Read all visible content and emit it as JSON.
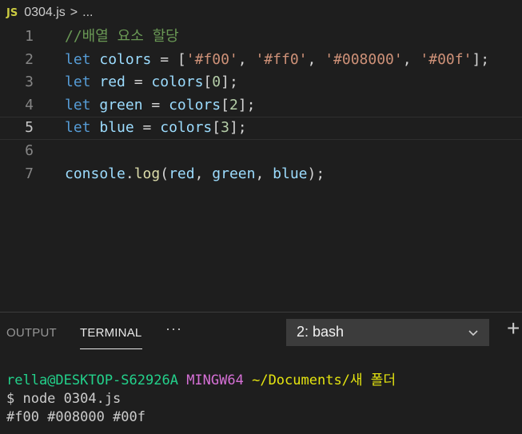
{
  "breadcrumb": {
    "lang_badge": "JS",
    "file_name": "0304.js",
    "separator": ">",
    "more": "..."
  },
  "editor": {
    "lines": [
      {
        "number": "1",
        "tokens": [
          {
            "t": "//배열 요소 할당",
            "k": "comment"
          }
        ]
      },
      {
        "number": "2",
        "tokens": [
          {
            "t": "let",
            "k": "keyword"
          },
          {
            "t": " ",
            "k": "punc"
          },
          {
            "t": "colors",
            "k": "var"
          },
          {
            "t": " = [",
            "k": "punc"
          },
          {
            "t": "'#f00'",
            "k": "str"
          },
          {
            "t": ", ",
            "k": "punc"
          },
          {
            "t": "'#ff0'",
            "k": "str"
          },
          {
            "t": ", ",
            "k": "punc"
          },
          {
            "t": "'#008000'",
            "k": "str"
          },
          {
            "t": ", ",
            "k": "punc"
          },
          {
            "t": "'#00f'",
            "k": "str"
          },
          {
            "t": "];",
            "k": "punc"
          }
        ]
      },
      {
        "number": "3",
        "tokens": [
          {
            "t": "let",
            "k": "keyword"
          },
          {
            "t": " ",
            "k": "punc"
          },
          {
            "t": "red",
            "k": "var"
          },
          {
            "t": " = ",
            "k": "punc"
          },
          {
            "t": "colors",
            "k": "var"
          },
          {
            "t": "[",
            "k": "punc"
          },
          {
            "t": "0",
            "k": "num"
          },
          {
            "t": "];",
            "k": "punc"
          }
        ]
      },
      {
        "number": "4",
        "tokens": [
          {
            "t": "let",
            "k": "keyword"
          },
          {
            "t": " ",
            "k": "punc"
          },
          {
            "t": "green",
            "k": "var"
          },
          {
            "t": " = ",
            "k": "punc"
          },
          {
            "t": "colors",
            "k": "var"
          },
          {
            "t": "[",
            "k": "punc"
          },
          {
            "t": "2",
            "k": "num"
          },
          {
            "t": "];",
            "k": "punc"
          }
        ]
      },
      {
        "number": "5",
        "active": true,
        "tokens": [
          {
            "t": "let",
            "k": "keyword"
          },
          {
            "t": " ",
            "k": "punc"
          },
          {
            "t": "blue",
            "k": "var"
          },
          {
            "t": " = ",
            "k": "punc"
          },
          {
            "t": "colors",
            "k": "var"
          },
          {
            "t": "[",
            "k": "punc"
          },
          {
            "t": "3",
            "k": "num"
          },
          {
            "t": "];",
            "k": "punc"
          }
        ]
      },
      {
        "number": "6",
        "tokens": []
      },
      {
        "number": "7",
        "tokens": [
          {
            "t": "console",
            "k": "var"
          },
          {
            "t": ".",
            "k": "punc"
          },
          {
            "t": "log",
            "k": "fn"
          },
          {
            "t": "(",
            "k": "punc"
          },
          {
            "t": "red",
            "k": "var"
          },
          {
            "t": ", ",
            "k": "punc"
          },
          {
            "t": "green",
            "k": "var"
          },
          {
            "t": ", ",
            "k": "punc"
          },
          {
            "t": "blue",
            "k": "var"
          },
          {
            "t": ");",
            "k": "punc"
          }
        ]
      }
    ]
  },
  "panel": {
    "tab_output": "OUTPUT",
    "tab_terminal": "TERMINAL",
    "more_actions": "···",
    "terminal_select": "2: bash",
    "new_terminal": "+"
  },
  "terminal": {
    "prompt_user": "rella@DESKTOP-S62926A",
    "prompt_system": "MINGW64",
    "prompt_path": "~/Documents/새 폴더",
    "command": "$ node 0304.js",
    "output": "#f00 #008000 #00f"
  },
  "colors": {
    "background": "#1e1e1e",
    "keyword": "#569cd6",
    "variable": "#9cdcfe",
    "string": "#ce9178",
    "number": "#b5cea8",
    "comment": "#6a9955",
    "function": "#dcdcaa",
    "terminal_user": "#23d18b",
    "terminal_system": "#d670d6",
    "terminal_path": "#e5e510"
  },
  "icons": {
    "file_type": "javascript-file-icon",
    "breadcrumb_separator": "chevron-right-icon",
    "select_dropdown": "chevron-down-icon",
    "new_terminal": "plus-icon",
    "more_actions": "ellipsis-icon"
  }
}
